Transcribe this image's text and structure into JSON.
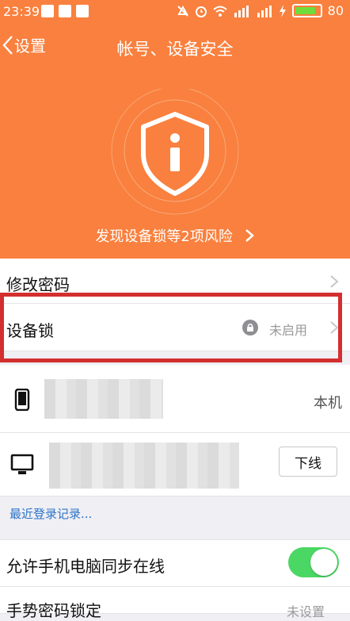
{
  "status_bar": {
    "time": "23:39",
    "battery": "80"
  },
  "nav": {
    "back_label": "设置",
    "title": "帐号、设备安全"
  },
  "hero": {
    "risk_text": "发现设备锁等2项风险",
    "accent_color": "#f9803e"
  },
  "menu": {
    "change_password": "修改密码",
    "device_lock": {
      "label": "设备锁",
      "status": "未启用"
    }
  },
  "devices": {
    "current_tag": "本机",
    "logout_label": "下线",
    "recent_login_link": "最近登录记录..."
  },
  "settings": {
    "sync_online": {
      "label": "允许手机电脑同步在线",
      "enabled": true
    },
    "gesture_lock": {
      "label": "手势密码锁定",
      "status": "未设置"
    }
  },
  "icons": [
    "back-chevron-icon",
    "shield-info-icon",
    "chevron-right-icon",
    "lock-icon",
    "phone-icon",
    "desktop-icon"
  ]
}
